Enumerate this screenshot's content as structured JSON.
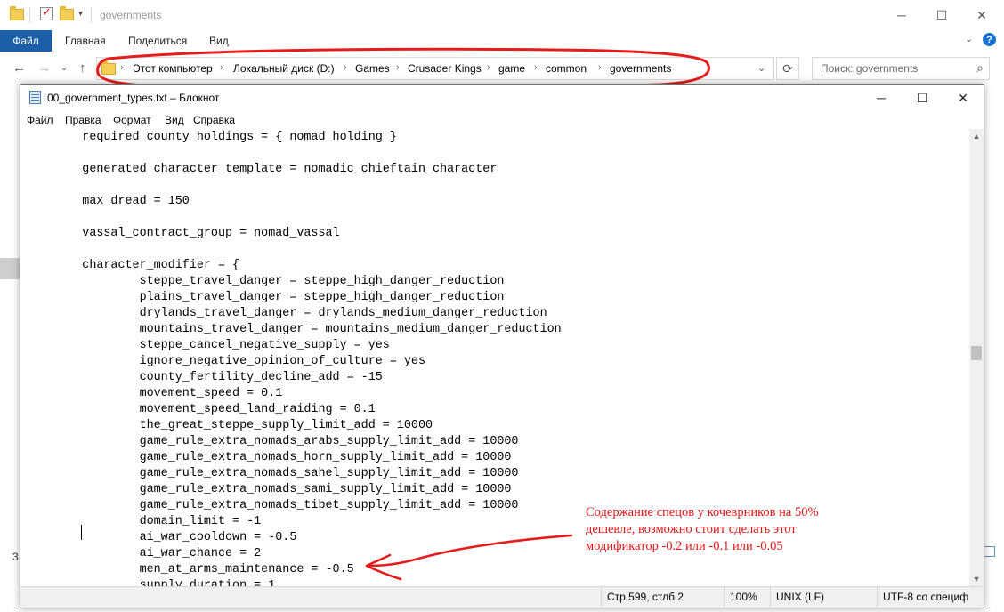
{
  "explorer": {
    "title": "governments",
    "ribbon": {
      "file_tab": "Файл",
      "tabs": [
        "Главная",
        "Поделиться",
        "Вид"
      ]
    },
    "address": {
      "crumbs": [
        "Этот компьютер",
        "Локальный диск (D:)",
        "Games",
        "Crusader Kings",
        "game",
        "common",
        "governments"
      ]
    },
    "search": {
      "placeholder": "Поиск: governments"
    },
    "left_number": "3"
  },
  "notepad": {
    "title": "00_government_types.txt – Блокнот",
    "menu": [
      "Файл",
      "Правка",
      "Формат",
      "Вид",
      "Справка"
    ],
    "lines": [
      "        required_county_holdings = { nomad_holding }",
      "",
      "        generated_character_template = nomadic_chieftain_character",
      "",
      "        max_dread = 150",
      "",
      "        vassal_contract_group = nomad_vassal",
      "",
      "        character_modifier = {",
      "                steppe_travel_danger = steppe_high_danger_reduction",
      "                plains_travel_danger = steppe_high_danger_reduction",
      "                drylands_travel_danger = drylands_medium_danger_reduction",
      "                mountains_travel_danger = mountains_medium_danger_reduction",
      "                steppe_cancel_negative_supply = yes",
      "                ignore_negative_opinion_of_culture = yes",
      "                county_fertility_decline_add = -15",
      "                movement_speed = 0.1",
      "                movement_speed_land_raiding = 0.1",
      "                the_great_steppe_supply_limit_add = 10000",
      "                game_rule_extra_nomads_arabs_supply_limit_add = 10000",
      "                game_rule_extra_nomads_horn_supply_limit_add = 10000",
      "                game_rule_extra_nomads_sahel_supply_limit_add = 10000",
      "                game_rule_extra_nomads_sami_supply_limit_add = 10000",
      "                game_rule_extra_nomads_tibet_supply_limit_add = 10000",
      "                domain_limit = -1",
      "                ai_war_cooldown = -0.5",
      "                ai_war_chance = 2",
      "                men_at_arms_maintenance = -0.5",
      "                supply_duration = 1"
    ],
    "status": {
      "position": "Стр 599, стлб 2",
      "zoom": "100%",
      "line_ending": "UNIX (LF)",
      "encoding": "UTF-8 со специф"
    }
  },
  "annotation": {
    "lines": [
      "Содержание спецов у кочеврников на 50%",
      "дешевле, возможно стоит сделать этот",
      "модификатор -0.2 или -0.1 или -0.05"
    ],
    "color": "#e01818"
  }
}
